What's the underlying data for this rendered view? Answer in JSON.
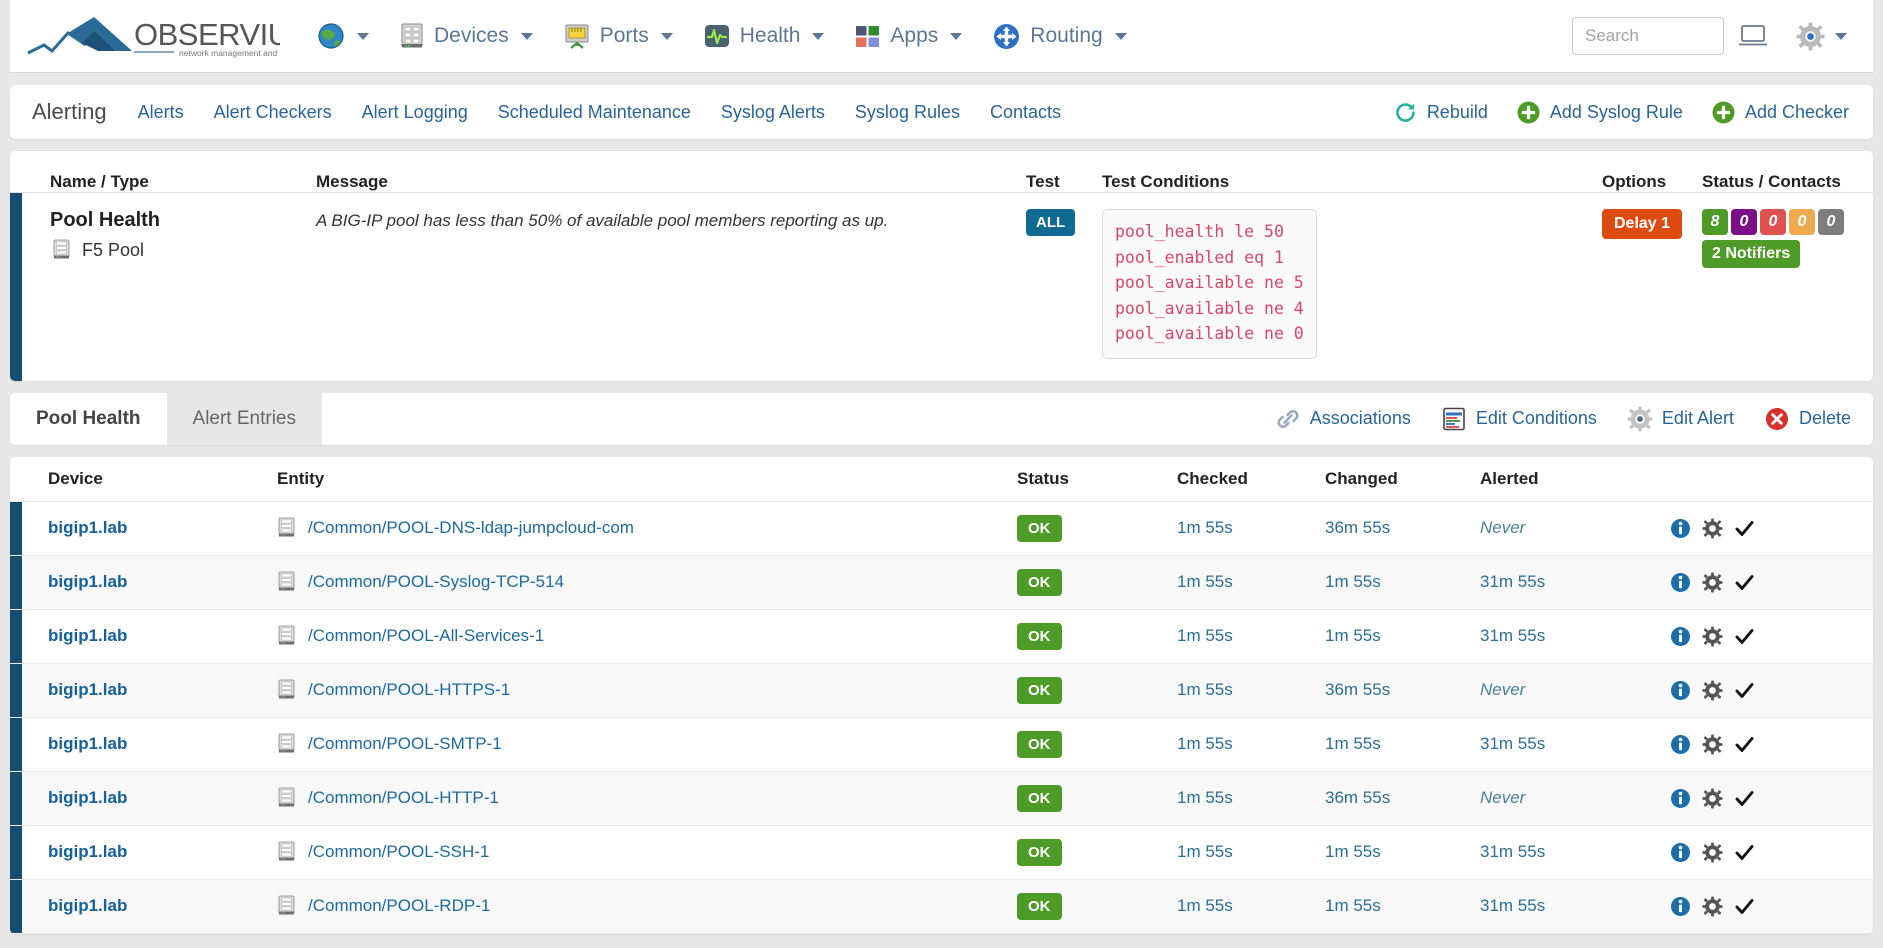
{
  "brand": {
    "name": "OBSERVIUM",
    "tagline": "network management and monitoring"
  },
  "navbar": {
    "items": [
      {
        "label": "",
        "icon": "globe-icon",
        "has_caret": true
      },
      {
        "label": "Devices",
        "icon": "server-rack-icon",
        "has_caret": true
      },
      {
        "label": "Ports",
        "icon": "port-icon",
        "has_caret": true
      },
      {
        "label": "Health",
        "icon": "heartbeat-icon",
        "has_caret": true
      },
      {
        "label": "Apps",
        "icon": "apps-grid-icon",
        "has_caret": true
      },
      {
        "label": "Routing",
        "icon": "routing-icon",
        "has_caret": true
      }
    ],
    "search_placeholder": "Search",
    "right_icons": [
      "monitor-icon",
      "gear-icon"
    ]
  },
  "subnav": {
    "title": "Alerting",
    "links": [
      "Alerts",
      "Alert Checkers",
      "Alert Logging",
      "Scheduled Maintenance",
      "Syslog Alerts",
      "Syslog Rules",
      "Contacts"
    ],
    "actions": [
      {
        "label": "Rebuild",
        "icon": "refresh-icon",
        "color": "#28b0a0"
      },
      {
        "label": "Add Syslog Rule",
        "icon": "plus-circle-icon",
        "color": "#4f9b28"
      },
      {
        "label": "Add Checker",
        "icon": "plus-circle-icon",
        "color": "#4f9b28"
      }
    ]
  },
  "alert_panel": {
    "headers": {
      "name": "Name / Type",
      "message": "Message",
      "test": "Test",
      "conditions": "Test Conditions",
      "options": "Options",
      "status": "Status / Contacts"
    },
    "name": "Pool Health",
    "type": "F5 Pool",
    "message": "A BIG-IP pool has less than 50% of available pool members reporting as up.",
    "test_badge": "ALL",
    "conditions": [
      "pool_health le 50",
      "pool_enabled eq 1",
      "pool_available ne 5",
      "pool_available ne 4",
      "pool_available ne 0"
    ],
    "options_badge": "Delay 1",
    "status_badges": [
      {
        "value": "8",
        "color": "#4f9b28"
      },
      {
        "value": "0",
        "color": "#7b0f85"
      },
      {
        "value": "0",
        "color": "#de5252"
      },
      {
        "value": "0",
        "color": "#eeaa4d"
      },
      {
        "value": "0",
        "color": "#7d7d7d"
      }
    ],
    "notifiers": "2 Notifiers"
  },
  "toolbar": {
    "tabs": [
      {
        "label": "Pool Health",
        "active": true
      },
      {
        "label": "Alert Entries",
        "active": false
      }
    ],
    "actions": [
      {
        "label": "Associations",
        "icon": "link-icon"
      },
      {
        "label": "Edit Conditions",
        "icon": "code-editor-icon"
      },
      {
        "label": "Edit Alert",
        "icon": "gear-icon"
      },
      {
        "label": "Delete",
        "icon": "delete-circle-icon"
      }
    ]
  },
  "table": {
    "columns": [
      "Device",
      "Entity",
      "Status",
      "Checked",
      "Changed",
      "Alerted"
    ],
    "rows": [
      {
        "device": "bigip1.lab",
        "entity": "/Common/POOL-DNS-ldap-jumpcloud-com",
        "status": "OK",
        "checked": "1m 55s",
        "changed": "36m 55s",
        "alerted": "Never",
        "alerted_never": true
      },
      {
        "device": "bigip1.lab",
        "entity": "/Common/POOL-Syslog-TCP-514",
        "status": "OK",
        "checked": "1m 55s",
        "changed": "1m 55s",
        "alerted": "31m 55s",
        "alerted_never": false
      },
      {
        "device": "bigip1.lab",
        "entity": "/Common/POOL-All-Services-1",
        "status": "OK",
        "checked": "1m 55s",
        "changed": "1m 55s",
        "alerted": "31m 55s",
        "alerted_never": false
      },
      {
        "device": "bigip1.lab",
        "entity": "/Common/POOL-HTTPS-1",
        "status": "OK",
        "checked": "1m 55s",
        "changed": "36m 55s",
        "alerted": "Never",
        "alerted_never": true
      },
      {
        "device": "bigip1.lab",
        "entity": "/Common/POOL-SMTP-1",
        "status": "OK",
        "checked": "1m 55s",
        "changed": "1m 55s",
        "alerted": "31m 55s",
        "alerted_never": false
      },
      {
        "device": "bigip1.lab",
        "entity": "/Common/POOL-HTTP-1",
        "status": "OK",
        "checked": "1m 55s",
        "changed": "36m 55s",
        "alerted": "Never",
        "alerted_never": true
      },
      {
        "device": "bigip1.lab",
        "entity": "/Common/POOL-SSH-1",
        "status": "OK",
        "checked": "1m 55s",
        "changed": "1m 55s",
        "alerted": "31m 55s",
        "alerted_never": false
      },
      {
        "device": "bigip1.lab",
        "entity": "/Common/POOL-RDP-1",
        "status": "OK",
        "checked": "1m 55s",
        "changed": "1m 55s",
        "alerted": "31m 55s",
        "alerted_never": false
      }
    ],
    "row_icons": [
      "info-icon",
      "gear-icon",
      "check-icon"
    ]
  },
  "colors": {
    "accent_navy": "#164c72",
    "link_blue": "#2a6496",
    "green": "#4f9b28",
    "orange_delay": "#dd4b11",
    "teal_badge": "#0f6a91",
    "code_pink": "#d9456c"
  }
}
